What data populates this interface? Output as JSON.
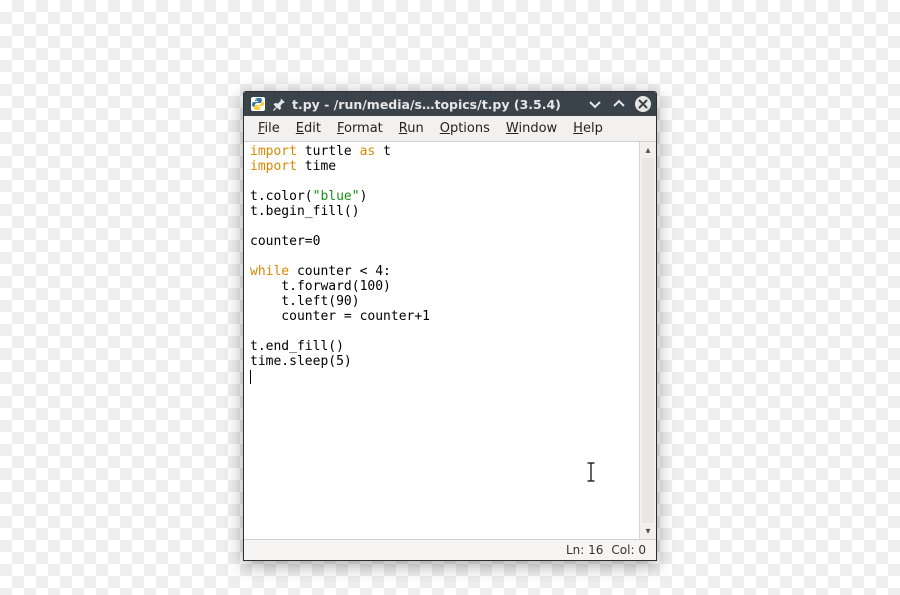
{
  "titlebar": {
    "title": "t.py - /run/media/s…topics/t.py (3.5.4)"
  },
  "menubar": {
    "items": [
      {
        "label": "File",
        "mn": "F",
        "rest": "ile"
      },
      {
        "label": "Edit",
        "mn": "E",
        "rest": "dit"
      },
      {
        "label": "Format",
        "mn": "F",
        "rest": "ormat"
      },
      {
        "label": "Run",
        "mn": "R",
        "rest": "un"
      },
      {
        "label": "Options",
        "mn": "O",
        "rest": "ptions"
      },
      {
        "label": "Window",
        "mn": "W",
        "rest": "indow"
      },
      {
        "label": "Help",
        "mn": "H",
        "rest": "elp"
      }
    ]
  },
  "code": {
    "lines": [
      [
        {
          "t": "import",
          "c": "kw"
        },
        {
          "t": " turtle "
        },
        {
          "t": "as",
          "c": "kw"
        },
        {
          "t": " t"
        }
      ],
      [
        {
          "t": "import",
          "c": "kw"
        },
        {
          "t": " time"
        }
      ],
      [],
      [
        {
          "t": "t.color("
        },
        {
          "t": "\"blue\"",
          "c": "str"
        },
        {
          "t": ")"
        }
      ],
      [
        {
          "t": "t.begin_fill()"
        }
      ],
      [],
      [
        {
          "t": "counter=0"
        }
      ],
      [],
      [
        {
          "t": "while",
          "c": "kw"
        },
        {
          "t": " counter < 4:"
        }
      ],
      [
        {
          "t": "    t.forward(100)"
        }
      ],
      [
        {
          "t": "    t.left(90)"
        }
      ],
      [
        {
          "t": "    counter = counter+1"
        }
      ],
      [],
      [
        {
          "t": "t.end_fill()"
        }
      ],
      [
        {
          "t": "time.sleep(5)"
        }
      ],
      [
        {
          "t": "",
          "caret": true
        }
      ]
    ]
  },
  "status": {
    "ln_label": "Ln:",
    "ln": "16",
    "col_label": "Col:",
    "col": "0"
  }
}
